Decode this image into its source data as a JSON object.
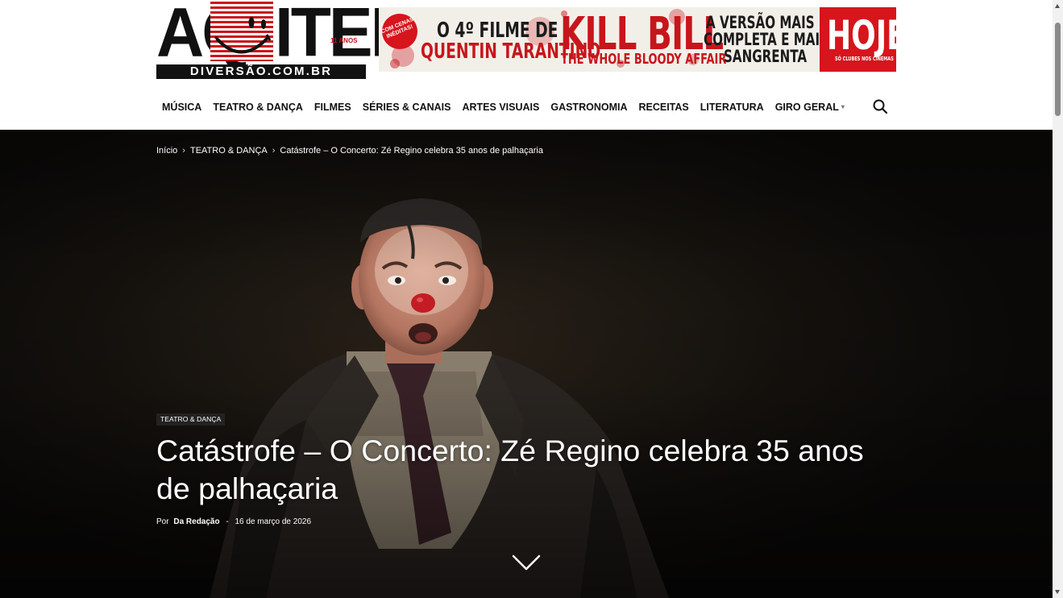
{
  "logo": {
    "left_word": "AQ",
    "right_word": "ITEM",
    "years": "11 ANOS",
    "domain": "DIVERSÃO.COM.BR"
  },
  "ad_banner": {
    "seal": "COM CENAS INÉDITAS!",
    "line1": "O 4º FILME DE",
    "line2": "QUENTIN TARANTINO",
    "movie_title": "KILL BILL",
    "movie_subtitle": "THE WHOLE BLOODY AFFAIR",
    "tagline1": "A VERSÃO MAIS",
    "tagline2": "COMPLETA E MAIS",
    "tagline3": "SANGRENTA",
    "cta": "HOJE",
    "cta_sub": "SÓ CLUBES NOS CINEMAS",
    "accent_color": "#d6151c"
  },
  "nav": {
    "items": [
      "MÚSICA",
      "TEATRO & DANÇA",
      "FILMES",
      "SÉRIES & CANAIS",
      "ARTES VISUAIS",
      "GASTRONOMIA",
      "RECEITAS",
      "LITERATURA",
      "GIRO GERAL"
    ],
    "search_icon": "search-icon"
  },
  "breadcrumb": {
    "home": "Início",
    "category": "TEATRO & DANÇA",
    "current": "Catástrofe – O Concerto: Zé Regino celebra 35 anos de palhaçaria"
  },
  "article": {
    "category_badge": "TEATRO & DANÇA",
    "title": "Catástrofe – O Concerto: Zé Regino celebra 35 anos de palhaçaria",
    "by_label": "Por",
    "author": "Da Redação",
    "separator": "-",
    "date": "16 de março de 2026",
    "scroll_icon": "chevron-down-icon"
  }
}
